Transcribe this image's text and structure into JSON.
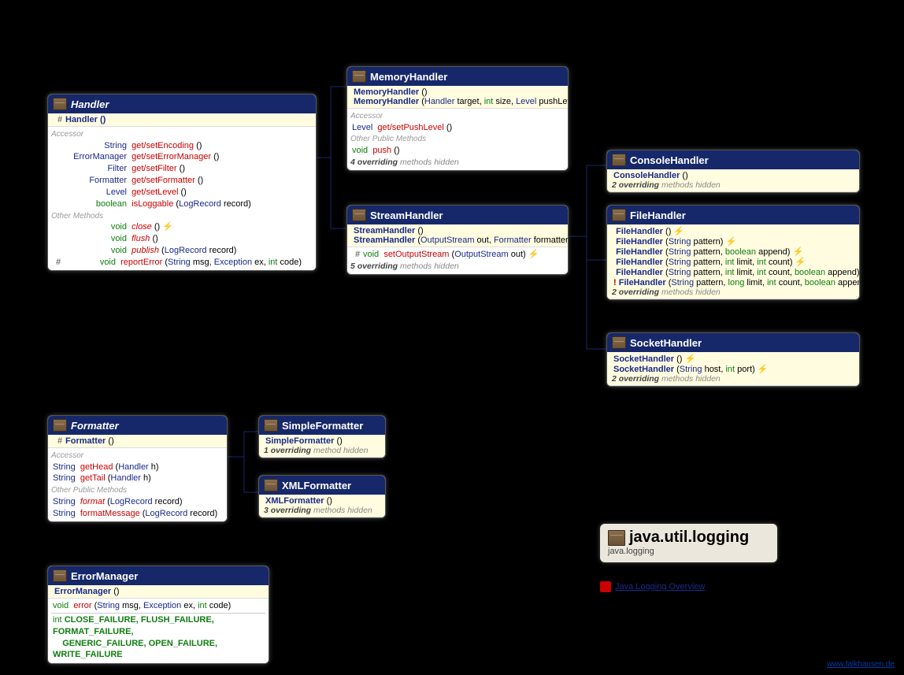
{
  "handler": {
    "title": "Handler",
    "ctor": {
      "vis": "#",
      "name": "Handler ()"
    },
    "accessor_label": "Accessor",
    "rows_accessor": [
      {
        "ret": "String",
        "m": "get/setEncoding ()",
        "retcls": "ret"
      },
      {
        "ret": "ErrorManager",
        "m": "get/setErrorManager ()",
        "retcls": "ret"
      },
      {
        "ret": "Filter",
        "m": "get/setFilter ()",
        "retcls": "ret"
      },
      {
        "ret": "Formatter",
        "m": "get/setFormatter ()",
        "retcls": "ret"
      },
      {
        "ret": "Level",
        "m": "get/setLevel ()",
        "retcls": "ret"
      },
      {
        "ret": "boolean",
        "m": "isLoggable",
        "retcls": "ret-green",
        "param": "(LogRecord record)"
      }
    ],
    "other_label": "Other Methods",
    "rows_other": [
      {
        "ret": "void",
        "m": "close",
        "mc": "name-red",
        "suffix": " () ",
        "exc": "⚡"
      },
      {
        "ret": "void",
        "m": "flush",
        "mc": "name-red",
        "suffix": " ()"
      },
      {
        "ret": "void",
        "m": "publish",
        "mc": "name-red",
        "param": "(LogRecord record)"
      },
      {
        "vis": "#",
        "ret": "void",
        "m": "reportError",
        "mc": "name-red",
        "param": "(String msg, Exception ex, int code)",
        "mixed": true
      }
    ]
  },
  "memory": {
    "title": "MemoryHandler",
    "ctors": [
      "MemoryHandler ()",
      "MemoryHandler (Handler target, int size, Level pushLevel)"
    ],
    "accessor_label": "Accessor",
    "accessor": [
      {
        "ret": "Level",
        "m": "get/setPushLevel ()"
      }
    ],
    "other_label": "Other Public Methods",
    "other": [
      {
        "ret": "void",
        "m": "push ()"
      }
    ],
    "hidden": "4 overriding methods hidden"
  },
  "stream": {
    "title": "StreamHandler",
    "ctors": [
      "StreamHandler ()",
      "StreamHandler (OutputStream out, Formatter formatter)"
    ],
    "body": [
      {
        "vis": "#",
        "ret": "void",
        "m": "setOutputStream",
        "param": "(OutputStream out)",
        "exc": "⚡"
      }
    ],
    "hidden": "5 overriding methods hidden"
  },
  "console": {
    "title": "ConsoleHandler",
    "ctors": [
      "ConsoleHandler ()"
    ],
    "hidden": "2 overriding methods hidden"
  },
  "file": {
    "title": "FileHandler",
    "ctors": [
      {
        "sig": "FileHandler ()",
        "exc": true
      },
      {
        "sig": "FileHandler (String pattern)",
        "exc": true
      },
      {
        "sig": "FileHandler (String pattern, boolean append)",
        "exc": true,
        "green": [
          23,
          37
        ]
      },
      {
        "sig": "FileHandler (String pattern, int limit, int count)",
        "exc": true,
        "ints": true
      },
      {
        "sig": "FileHandler (String pattern, int limit, int count, boolean append)",
        "exc": true,
        "ints": true,
        "green": [
          38,
          52
        ]
      },
      {
        "mark": "!",
        "sig": "FileHandler (String pattern, long limit, int count, boolean append)",
        "exc": true,
        "ints": true,
        "green": [
          39,
          53
        ]
      }
    ],
    "hidden": "2 overriding methods hidden"
  },
  "socket": {
    "title": "SocketHandler",
    "ctors": [
      {
        "sig": "SocketHandler ()",
        "exc": true
      },
      {
        "sig": "SocketHandler (String host, int port)",
        "exc": true
      }
    ],
    "hidden": "2 overriding methods hidden"
  },
  "formatter": {
    "title": "Formatter",
    "ctor": {
      "vis": "#",
      "name": "Formatter ()"
    },
    "accessor_label": "Accessor",
    "accessor": [
      {
        "ret": "String",
        "m": "getHead",
        "param": "(Handler h)"
      },
      {
        "ret": "String",
        "m": "getTail",
        "param": "(Handler h)"
      }
    ],
    "other_label": "Other Public Methods",
    "other": [
      {
        "ret": "String",
        "m": "format",
        "mc": "name-red",
        "param": "(LogRecord record)"
      },
      {
        "ret": "String",
        "m": "formatMessage",
        "param": "(LogRecord record)"
      }
    ]
  },
  "simplefmt": {
    "title": "SimpleFormatter",
    "ctors": [
      "SimpleFormatter ()"
    ],
    "hidden": "1 overriding method hidden"
  },
  "xmlfmt": {
    "title": "XMLFormatter",
    "ctors": [
      "XMLFormatter ()"
    ],
    "hidden": "3 overriding methods hidden"
  },
  "errormgr": {
    "title": "ErrorManager",
    "ctors": [
      "ErrorManager ()"
    ],
    "body": [
      {
        "ret": "void",
        "m": "error",
        "param": "(String msg, Exception ex, int code)"
      }
    ],
    "consts": "int CLOSE_FAILURE, FLUSH_FAILURE, FORMAT_FAILURE,\n    GENERIC_FAILURE, OPEN_FAILURE, WRITE_FAILURE"
  },
  "info": {
    "title": "java.util.logging",
    "sub": "java.logging",
    "link": "Java Logging Overview"
  },
  "watermark": "www.falkhausen.de"
}
